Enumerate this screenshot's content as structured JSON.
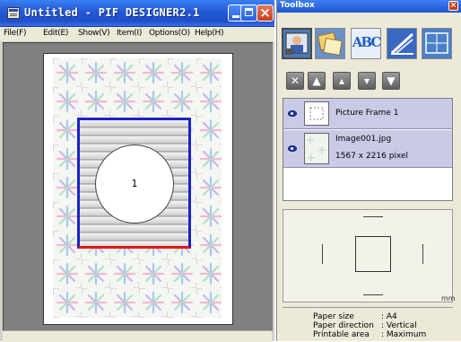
{
  "window": {
    "title": "Untitled - PIF DESIGNER2.1",
    "minimize_label": "minimize",
    "maximize_label": "maximize",
    "close_label": "close"
  },
  "menu": [
    "File(F)",
    "Edit(E)",
    "Show(V)",
    "Item(I)",
    "Options(O)",
    "Help(H)"
  ],
  "canvas": {
    "frame_number": "1",
    "accent_colors": {
      "frame_side": "#1a22c8",
      "frame_bottom": "#e01616"
    }
  },
  "toolbox": {
    "title": "Toolbox",
    "tools": [
      "photo-tool-icon",
      "frame-tool-icon",
      "text-tool-icon",
      "chart-tool-icon",
      "layout-tool-icon"
    ],
    "text_tool_glyph": "ABC",
    "order_buttons": [
      "delete-icon",
      "bring-front-icon",
      "move-up-icon",
      "move-down-icon",
      "send-back-icon"
    ],
    "layers": [
      {
        "name": "Picture Frame 1"
      },
      {
        "name": "Image001.jpg",
        "detail": "1567 x 2216 pixel"
      }
    ],
    "unit": "mm",
    "info": [
      {
        "label": "Paper size",
        "value": ": A4"
      },
      {
        "label": "Paper direction",
        "value": ": Vertical"
      },
      {
        "label": "Printable area",
        "value": ": Maximum"
      }
    ]
  }
}
